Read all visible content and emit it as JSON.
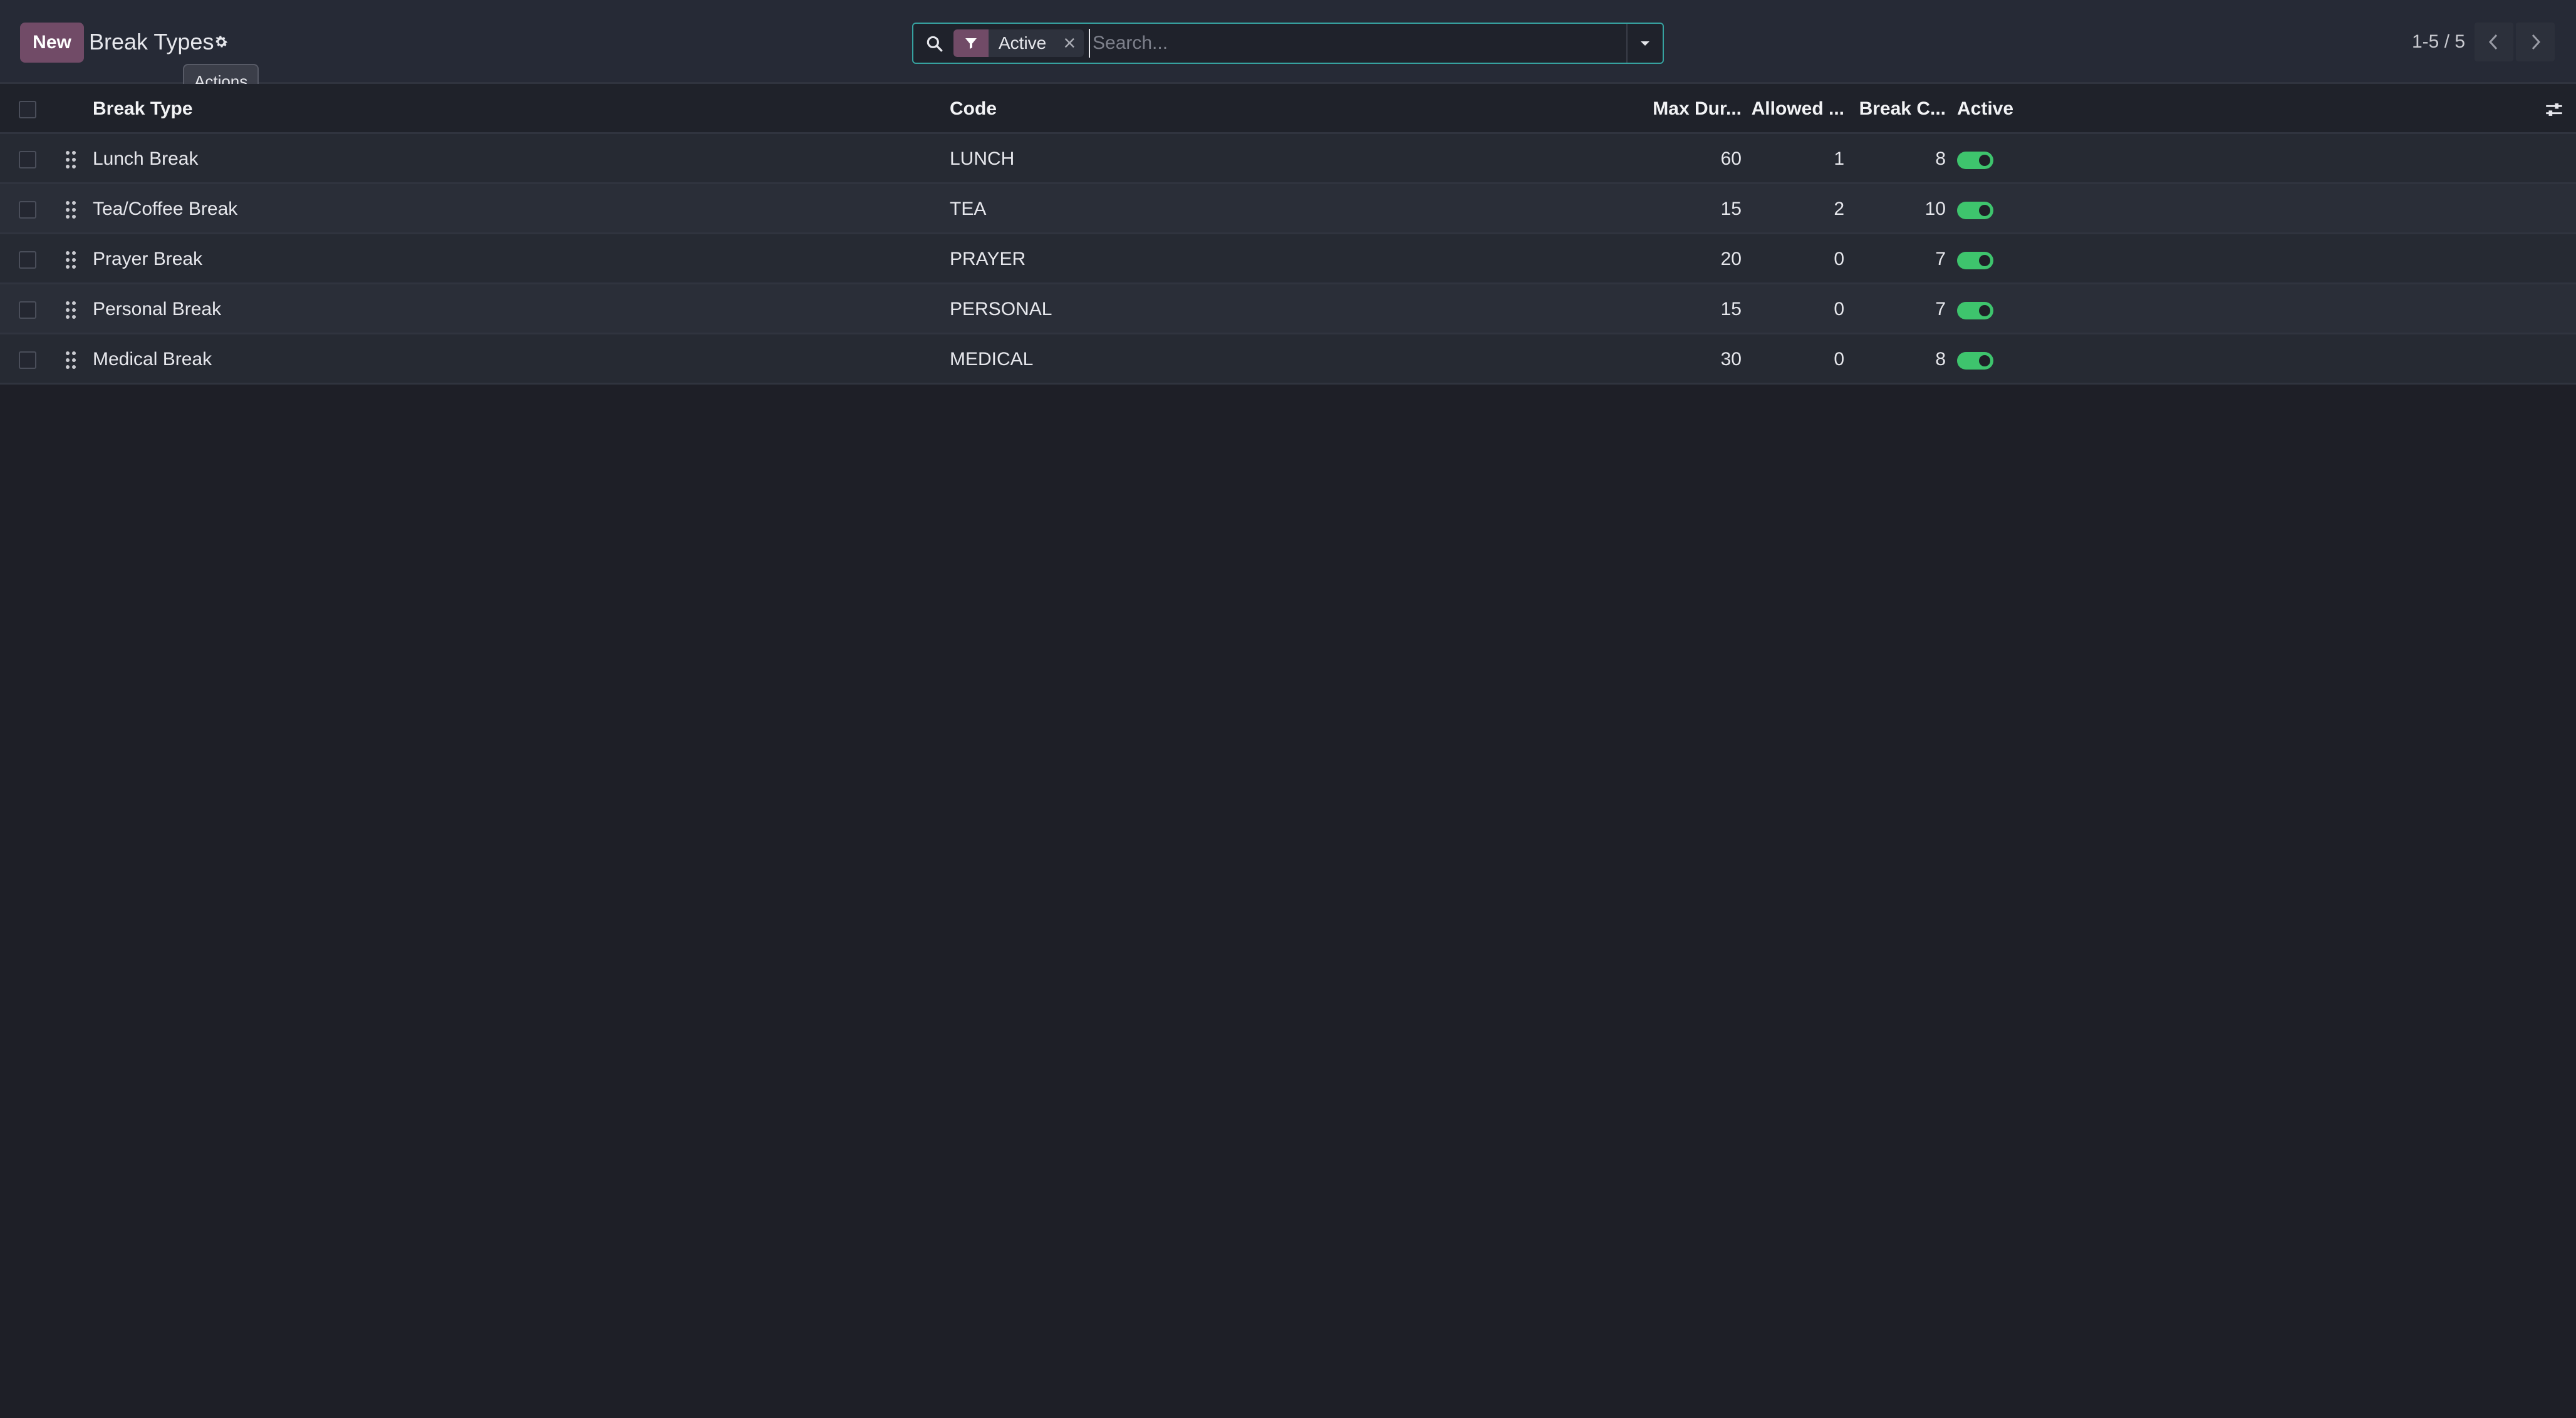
{
  "control_panel": {
    "new_label": "New",
    "title": "Break Types",
    "tooltip": "Actions"
  },
  "search": {
    "facet_label": "Active",
    "placeholder": "Search..."
  },
  "pager": {
    "value": "1-5 / 5"
  },
  "table": {
    "headers": {
      "name": "Break Type",
      "code": "Code",
      "max_duration": "Max Dur...",
      "allowed": "Allowed ...",
      "break_count": "Break C...",
      "active": "Active"
    },
    "rows": [
      {
        "name": "Lunch Break",
        "code": "LUNCH",
        "max_duration": "60",
        "allowed": "1",
        "break_count": "8",
        "active": true
      },
      {
        "name": "Tea/Coffee Break",
        "code": "TEA",
        "max_duration": "15",
        "allowed": "2",
        "break_count": "10",
        "active": true
      },
      {
        "name": "Prayer Break",
        "code": "PRAYER",
        "max_duration": "20",
        "allowed": "0",
        "break_count": "7",
        "active": true
      },
      {
        "name": "Personal Break",
        "code": "PERSONAL",
        "max_duration": "15",
        "allowed": "0",
        "break_count": "7",
        "active": true
      },
      {
        "name": "Medical Break",
        "code": "MEDICAL",
        "max_duration": "30",
        "allowed": "0",
        "break_count": "8",
        "active": true
      }
    ]
  },
  "colors": {
    "brand": "#714b67",
    "toggle_on": "#3ec46d",
    "search_focus": "#36a2a0",
    "background": "#1e1f27"
  },
  "icons": {
    "settings": "gear-icon",
    "search": "search-icon",
    "filter": "filter-icon",
    "remove_facet": "close-icon",
    "search_toggle": "caret-down-icon",
    "prev": "chevron-left-icon",
    "next": "chevron-right-icon",
    "drag": "drag-handle-icon",
    "optional_columns": "sliders-icon"
  }
}
